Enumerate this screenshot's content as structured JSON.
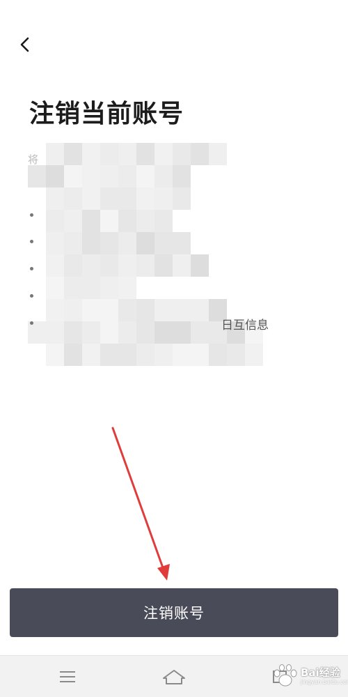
{
  "header": {
    "back_icon": "chevron-left-icon",
    "title": "注销当前账号"
  },
  "content": {
    "lead_char": "将",
    "last_item_tail": "日互信息",
    "bullet_count": 5
  },
  "action": {
    "button_label": "注销账号",
    "button_color": "#4a4b59"
  },
  "annotation": {
    "arrow_color": "#e03c3c"
  },
  "navbar": {
    "items": [
      "menu-icon",
      "home-icon",
      "back-icon"
    ]
  },
  "watermark": {
    "brand_text": "Bai经验",
    "sub_text": "jingyan.baidu.com"
  }
}
